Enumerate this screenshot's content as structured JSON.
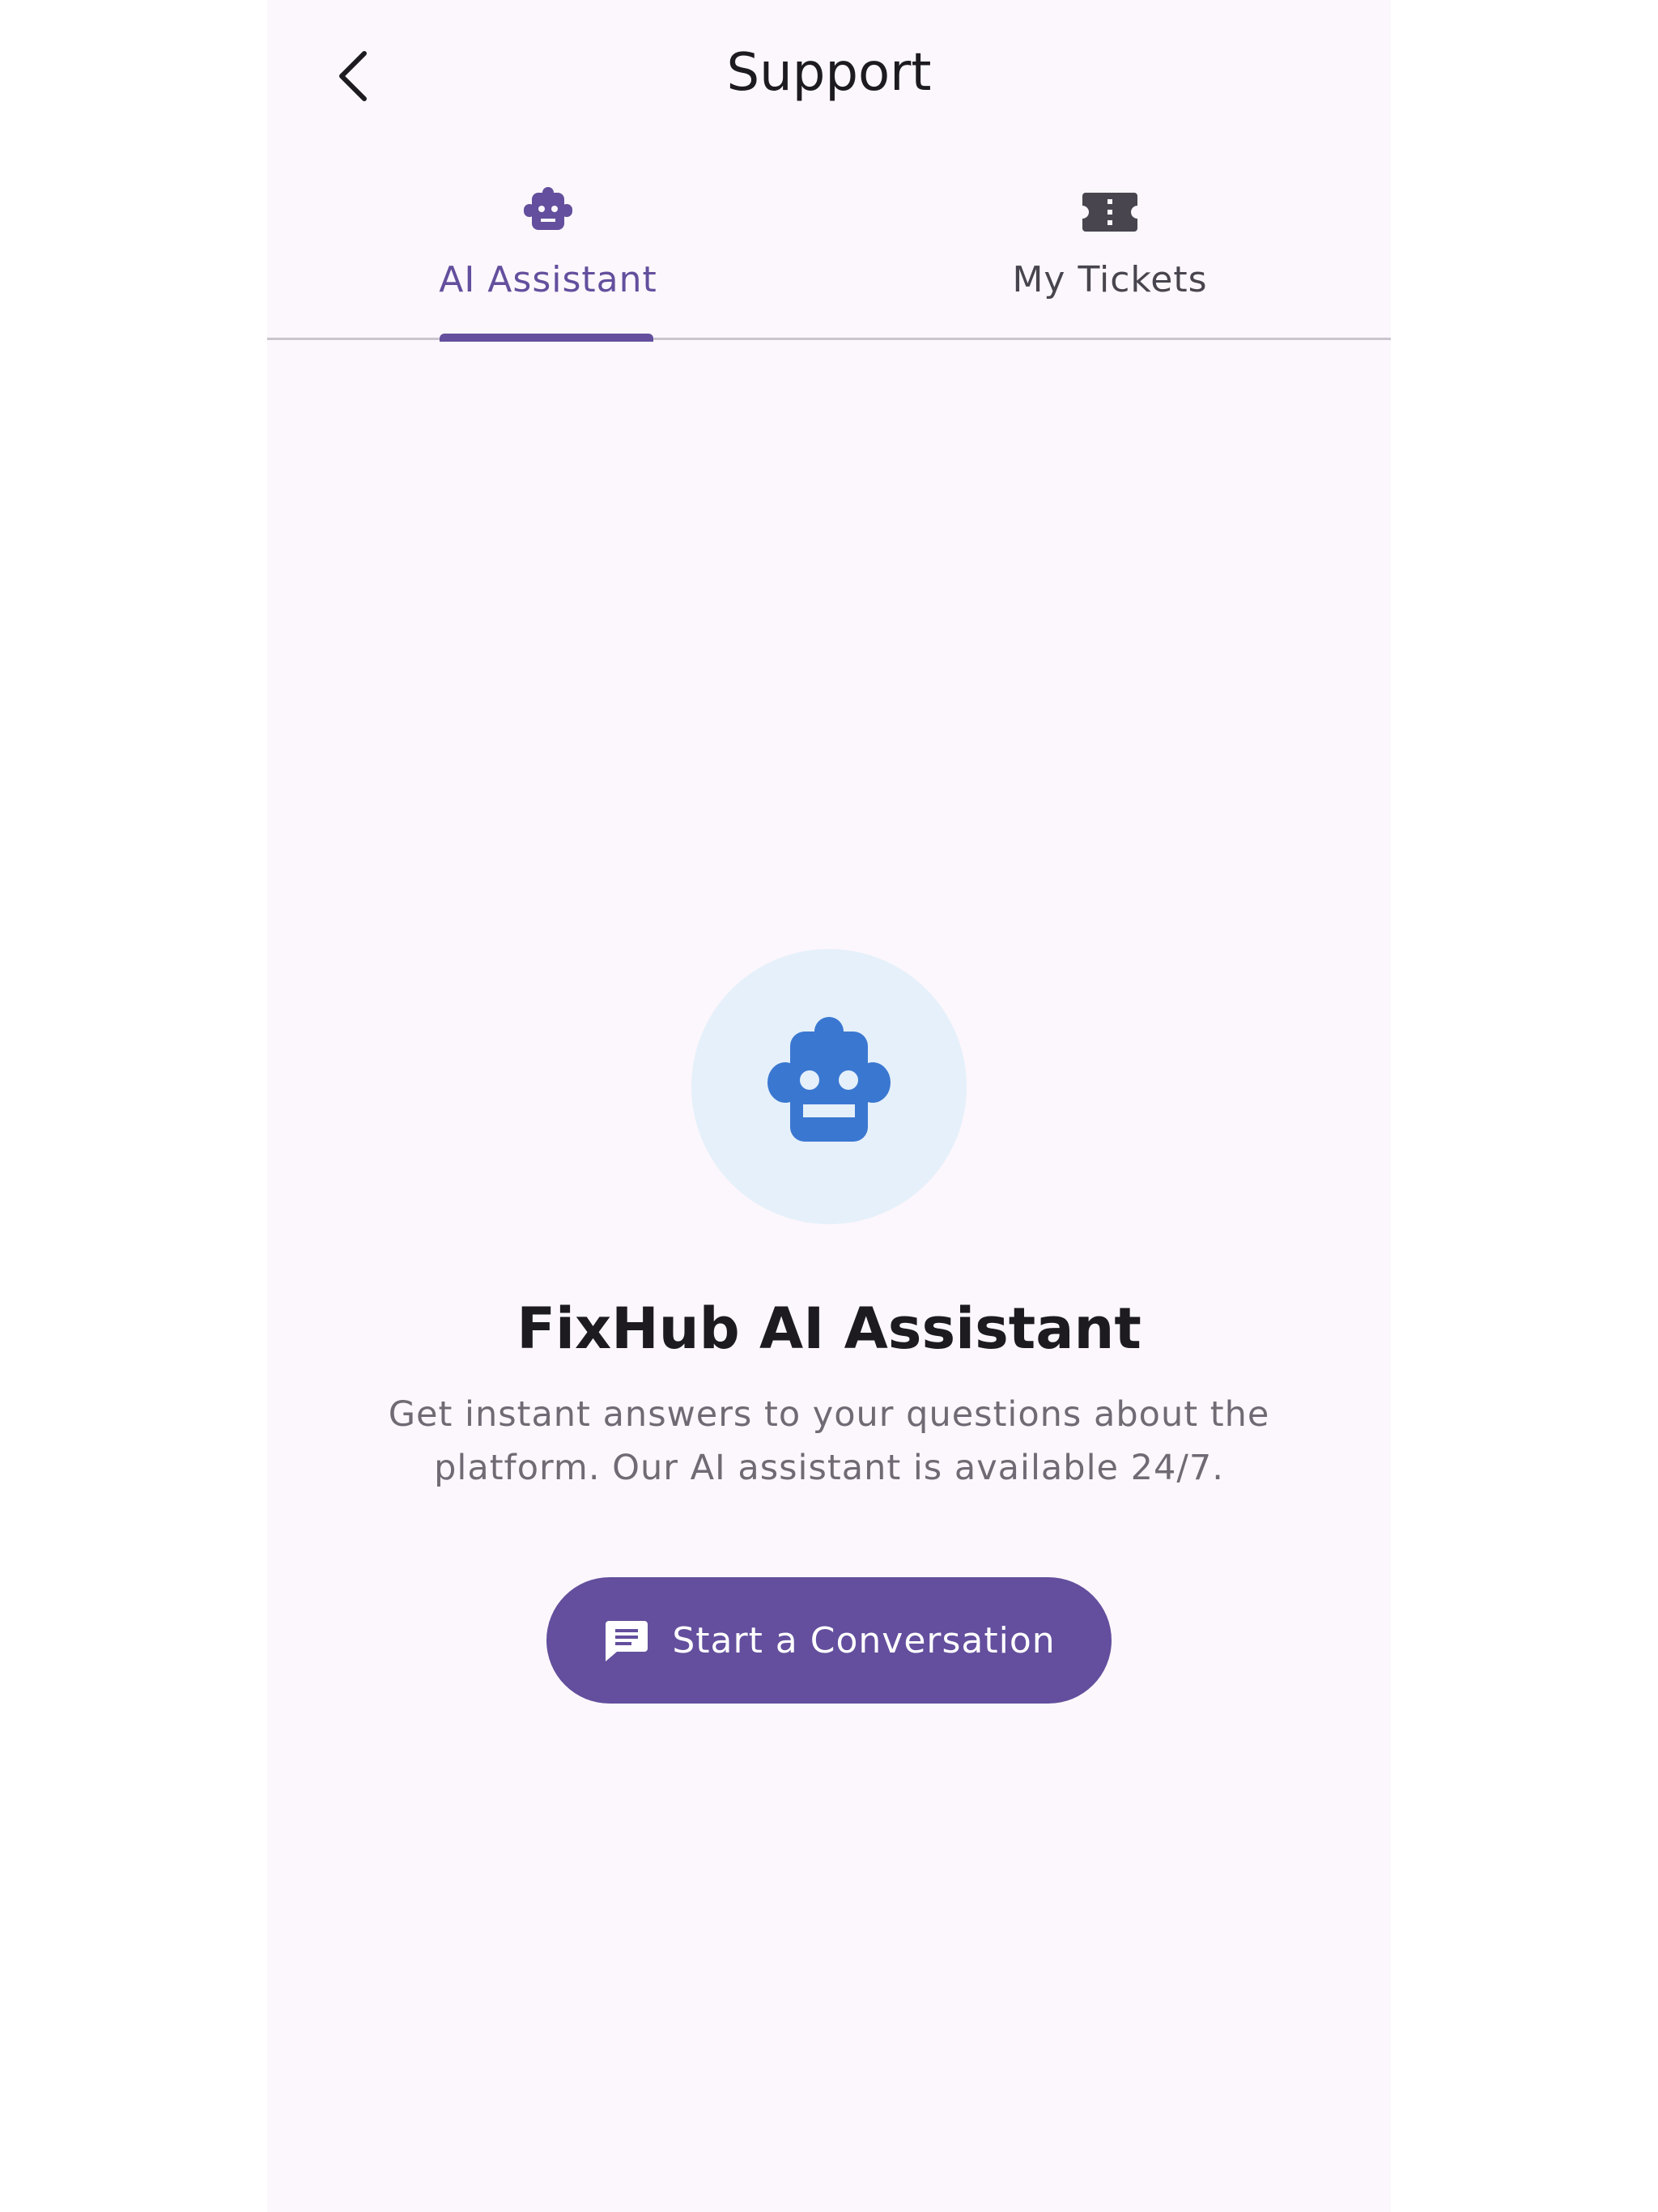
{
  "header": {
    "title": "Support",
    "back_icon": "chevron-left-icon"
  },
  "tabs": [
    {
      "label": "AI Assistant",
      "icon": "robot-icon",
      "active": true
    },
    {
      "label": "My Tickets",
      "icon": "ticket-icon",
      "active": false
    }
  ],
  "hero": {
    "icon": "robot-icon",
    "title": "FixHub AI Assistant",
    "description": "Get instant answers to your questions about the platform. Our AI assistant is available 24/7."
  },
  "cta": {
    "label": "Start a Conversation",
    "icon": "chat-icon"
  },
  "colors": {
    "primary": "#634f9d",
    "background": "#fcf7fc",
    "hero_circle": "#e5f0fa",
    "hero_robot": "#3a77d1",
    "text_dark": "#1d1b20",
    "text_muted": "#6f6a74"
  }
}
